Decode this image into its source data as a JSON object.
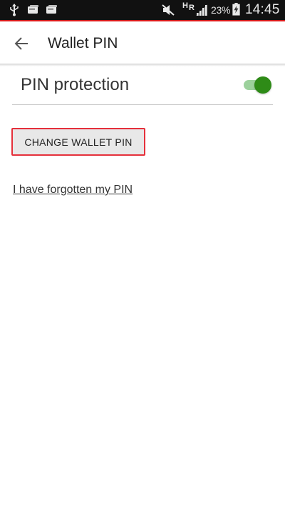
{
  "status_bar": {
    "battery_percent": "23%",
    "clock": "14:45",
    "network_types": [
      "H",
      "R"
    ],
    "icons": [
      "usb-icon",
      "notification-icon",
      "notification-icon",
      "mute-icon",
      "signal-icon",
      "battery-charging-icon"
    ]
  },
  "app_bar": {
    "title": "Wallet PIN",
    "back_icon": "arrow-back-icon"
  },
  "pin_protection": {
    "label": "PIN protection",
    "enabled": true
  },
  "change_pin_button": {
    "label": "CHANGE WALLET PIN"
  },
  "forgot_link": {
    "label": "I have forgotten my PIN"
  },
  "colors": {
    "status_bar_bg": "#111111",
    "status_accent": "#d81b1b",
    "toggle_on": "#2e8b17",
    "button_border": "#e5303b"
  }
}
